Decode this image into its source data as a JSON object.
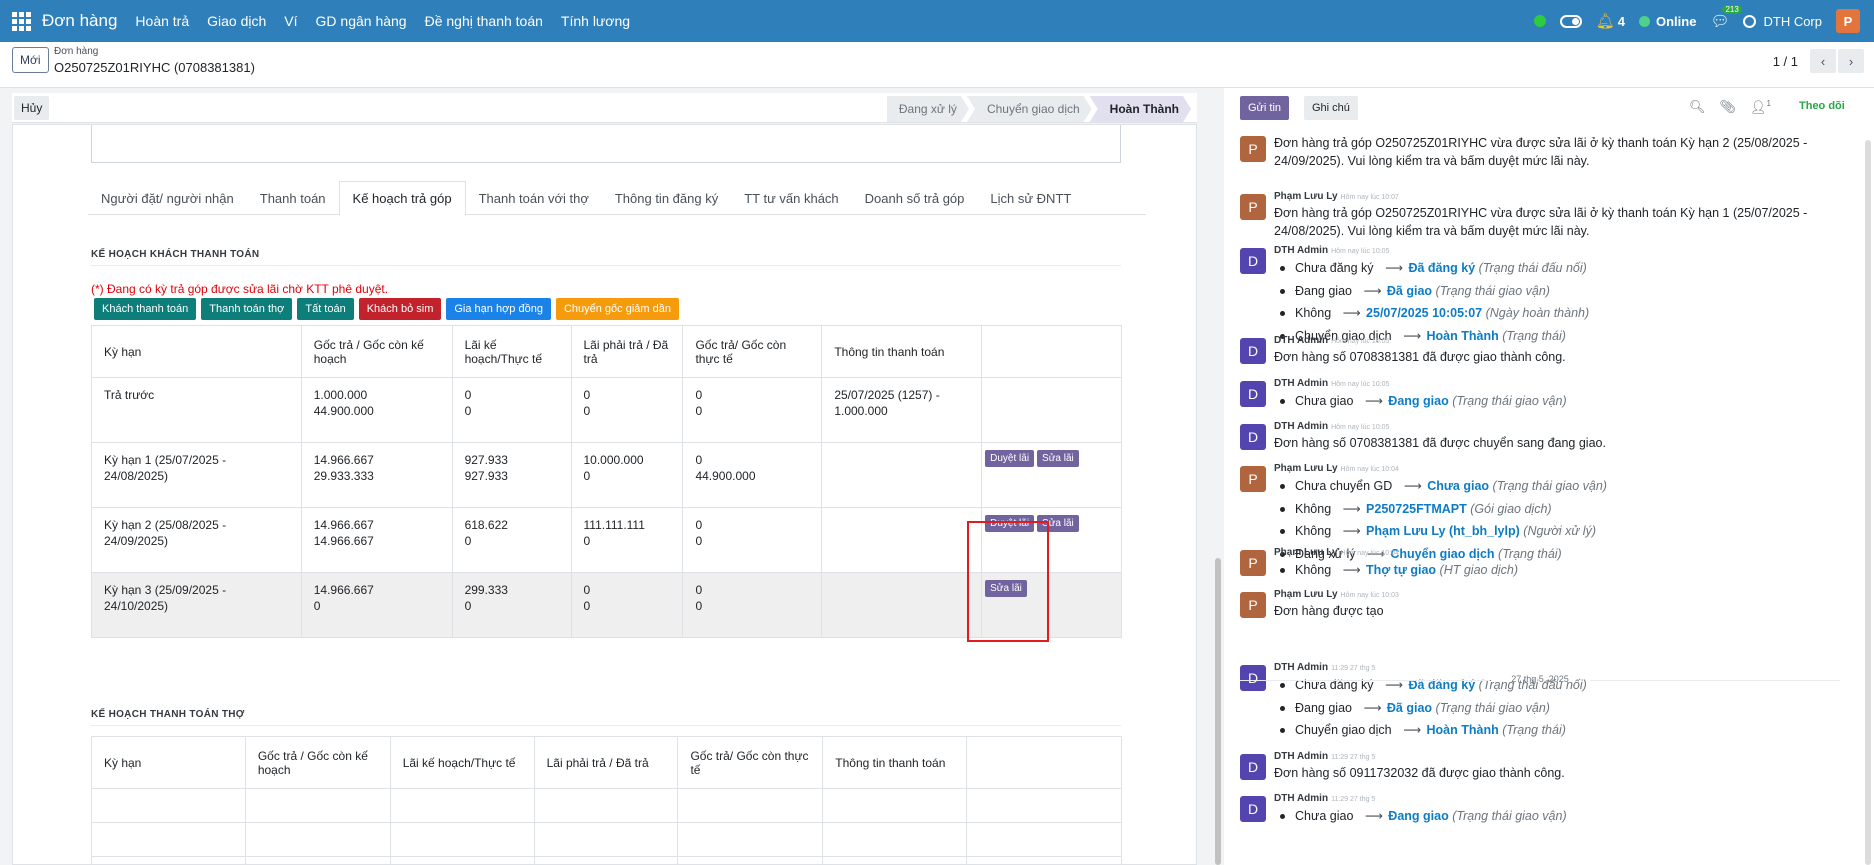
{
  "navbar": {
    "brand": "Đơn hàng",
    "menus": [
      "Hoàn trả",
      "Giao dịch",
      "Ví",
      "GD ngân hàng",
      "Đề nghị thanh toán",
      "Tính lương"
    ],
    "notif_count": "4",
    "status": "Online",
    "chat_count": "213",
    "company": "DTH Corp",
    "user_initial": "P"
  },
  "control": {
    "new_btn": "Mới",
    "breadcrumb_parent": "Đơn hàng",
    "breadcrumb_title": "O250725Z01RIYHC (0708381381)",
    "pager": "1 / 1"
  },
  "statusbar": {
    "cancel_btn": "Hủy",
    "stages": [
      "Đang xử lý",
      "Chuyển giao dịch",
      "Hoàn Thành"
    ],
    "active_stage": "Hoàn Thành"
  },
  "tabs": [
    "Người đặt/ người nhận",
    "Thanh toán",
    "Kế hoạch trả góp",
    "Thanh toán với thợ",
    "Thông tin đăng ký",
    "TT tư vấn khách",
    "Doanh số trả góp",
    "Lịch sử ĐNTT"
  ],
  "active_tab": "Kế hoạch trả góp",
  "plan": {
    "section_title": "KẾ HOẠCH KHÁCH THANH TOÁN",
    "warning": "(*) Đang có kỳ trả góp được sửa lãi chờ KTT phê duyệt.",
    "buttons": [
      "Khách thanh toán",
      "Thanh toán thợ",
      "Tất toán",
      "Khách bỏ sim",
      "Gia hạn hợp đồng",
      "Chuyển gốc giảm dần"
    ],
    "headers": [
      "Kỳ hạn",
      "Gốc trả / Gốc còn kế hoạch",
      "Lãi kế hoạch/Thực tế",
      "Lãi phải trả / Đã trả",
      "Gốc trả/ Gốc còn thực tế",
      "Thông tin thanh toán",
      ""
    ],
    "rows": [
      {
        "term": "Trả trước",
        "c1a": "1.000.000",
        "c1b": "44.900.000",
        "c2a": "0",
        "c2b": "0",
        "c3a": "0",
        "c3b": "0",
        "c4a": "0",
        "c4b": "0",
        "info": "25/07/2025 (1257) - 1.000.000",
        "approve": "",
        "edit": ""
      },
      {
        "term": "Kỳ hạn 1 (25/07/2025 - 24/08/2025)",
        "c1a": "14.966.667",
        "c1b": "29.933.333",
        "c2a": "927.933",
        "c2b": "927.933",
        "c3a": "10.000.000",
        "c3b": "0",
        "c4a": "0",
        "c4b": "44.900.000",
        "info": "",
        "approve": "Duyệt lãi",
        "edit": "Sửa lãi"
      },
      {
        "term": "Kỳ hạn 2 (25/08/2025 - 24/09/2025)",
        "c1a": "14.966.667",
        "c1b": "14.966.667",
        "c2a": "618.622",
        "c2b": "0",
        "c3a": "111.111.111",
        "c3b": "0",
        "c4a": "0",
        "c4b": "0",
        "info": "",
        "approve": "Duyệt lãi",
        "edit": "Sửa lãi"
      },
      {
        "term": "Kỳ hạn 3 (25/09/2025 - 24/10/2025)",
        "c1a": "14.966.667",
        "c1b": "0",
        "c2a": "299.333",
        "c2b": "0",
        "c3a": "0",
        "c3b": "0",
        "c4a": "0",
        "c4b": "0",
        "info": "",
        "approve": "",
        "edit": "Sửa lãi"
      }
    ]
  },
  "worker_plan": {
    "section_title": "KẾ HOẠCH THANH TOÁN THỢ",
    "headers": [
      "Kỳ hạn",
      "Gốc trả / Gốc còn kế hoạch",
      "Lãi kế hoạch/Thực tế",
      "Lãi phải trả / Đã trả",
      "Gốc trả/ Gốc còn thực tế",
      "Thông tin thanh toán",
      ""
    ]
  },
  "chatter": {
    "send_btn": "Gửi tin",
    "note_btn": "Ghi chú",
    "follower_count": "1",
    "follow_btn": "Theo dõi",
    "arrow": "⟶",
    "date_sep": "27 thg 5, 2025",
    "messages": [
      {
        "type": "text",
        "av": "P",
        "cls": "p",
        "author": "",
        "time": "",
        "text": "Đơn hàng trả góp O250725Z01RIYHC vừa được sửa lãi ở kỳ thanh toán Kỳ hạn 2 (25/08/2025 - 24/09/2025). Vui lòng kiểm tra và bấm duyệt mức lãi này."
      },
      {
        "type": "text",
        "av": "P",
        "cls": "p",
        "author": "Phạm Lưu Ly",
        "time": "Hôm nay lúc 10:07",
        "text": "Đơn hàng trả góp O250725Z01RIYHC vừa được sửa lãi ở kỳ thanh toán Kỳ hạn 1 (25/07/2025 - 24/08/2025). Vui lòng kiểm tra và bấm duyệt mức lãi này."
      },
      {
        "type": "track",
        "av": "D",
        "cls": "d",
        "author": "DTH Admin",
        "time": "Hôm nay lúc 10:05",
        "items": [
          {
            "from": "Chưa đăng ký",
            "to": "Đã đăng ký",
            "field": "(Trạng thái đấu nối)"
          },
          {
            "from": "Đang giao",
            "to": "Đã giao",
            "field": "(Trạng thái giao vận)"
          },
          {
            "from": "Không",
            "to": "25/07/2025 10:05:07",
            "field": "(Ngày hoàn thành)"
          },
          {
            "from": "Chuyển giao dịch",
            "to": "Hoàn Thành",
            "field": "(Trạng thái)"
          }
        ]
      },
      {
        "type": "text",
        "av": "D",
        "cls": "d",
        "author": "DTH Admin",
        "time": "Hôm nay lúc 10:05",
        "text": "Đơn hàng số 0708381381 đã được giao thành công."
      },
      {
        "type": "track",
        "av": "D",
        "cls": "d",
        "author": "DTH Admin",
        "time": "Hôm nay lúc 10:05",
        "items": [
          {
            "from": "Chưa giao",
            "to": "Đang giao",
            "field": "(Trạng thái giao vận)"
          }
        ]
      },
      {
        "type": "text",
        "av": "D",
        "cls": "d",
        "author": "DTH Admin",
        "time": "Hôm nay lúc 10:05",
        "text": "Đơn hàng số 0708381381 đã được chuyển sang đang giao."
      },
      {
        "type": "track",
        "av": "P",
        "cls": "p",
        "author": "Phạm Lưu Ly",
        "time": "Hôm nay lúc 10:04",
        "items": [
          {
            "from": "Chưa chuyển GD",
            "to": "Chưa giao",
            "field": "(Trạng thái giao vận)"
          },
          {
            "from": "Không",
            "to": "P250725FTMAPT",
            "field": "(Gói giao dịch)"
          },
          {
            "from": "Không",
            "to": "Phạm Lưu Ly (ht_bh_lylp)",
            "field": "(Người xử lý)"
          },
          {
            "from": "Đang xử lý",
            "to": "Chuyển giao dịch",
            "field": "(Trạng thái)"
          }
        ]
      },
      {
        "type": "track",
        "av": "P",
        "cls": "p",
        "author": "Phạm Lưu Ly",
        "time": "Hôm nay lúc 10:04",
        "items": [
          {
            "from": "Không",
            "to": "Thợ tự giao",
            "field": "(HT giao dịch)"
          }
        ]
      },
      {
        "type": "text",
        "av": "P",
        "cls": "p",
        "author": "Phạm Lưu Ly",
        "time": "Hôm nay lúc 10:03",
        "text": "Đơn hàng được tạo"
      },
      {
        "type": "track",
        "av": "D",
        "cls": "d",
        "author": "DTH Admin",
        "time": "11:29 27 thg 5",
        "items": [
          {
            "from": "Chưa đăng ký",
            "to": "Đã đăng ký",
            "field": "(Trạng thái đấu nối)"
          },
          {
            "from": "Đang giao",
            "to": "Đã giao",
            "field": "(Trạng thái giao vận)"
          },
          {
            "from": "Chuyển giao dịch",
            "to": "Hoàn Thành",
            "field": "(Trạng thái)"
          }
        ]
      },
      {
        "type": "text",
        "av": "D",
        "cls": "d",
        "author": "DTH Admin",
        "time": "11:29 27 thg 5",
        "text": "Đơn hàng số 0911732032 đã được giao thành công."
      },
      {
        "type": "track",
        "av": "D",
        "cls": "d",
        "author": "DTH Admin",
        "time": "11:29 27 thg 5",
        "items": [
          {
            "from": "Chưa giao",
            "to": "Đang giao",
            "field": "(Trạng thái giao vận)"
          }
        ]
      }
    ]
  }
}
